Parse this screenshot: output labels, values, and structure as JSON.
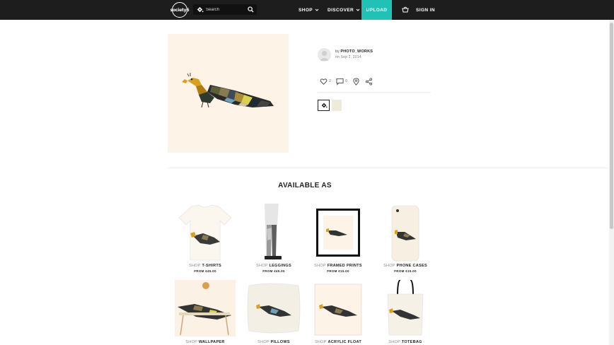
{
  "nav": {
    "logo_text": "society6",
    "search_placeholder": "Search",
    "shop": "SHOP",
    "discover": "DISCOVER",
    "upload": "UPLOAD",
    "sign_in": "SIGN IN"
  },
  "artwork": {
    "by_prefix": "by",
    "artist": "PHOTO_WORKS",
    "date": "on Sep 2, 2014",
    "likes": "2",
    "comments": "0"
  },
  "available_title": "AVAILABLE AS",
  "products": [
    {
      "shop": "SHOP",
      "name": "T-SHIRTS",
      "price": "FROM €45.00"
    },
    {
      "shop": "SHOP",
      "name": "LEGGINGS",
      "price": "FROM €45.00"
    },
    {
      "shop": "SHOP",
      "name": "FRAMED PRINTS",
      "price": "FROM €15.00"
    },
    {
      "shop": "SHOP",
      "name": "PHONE CASES",
      "price": "FROM €15.00"
    },
    {
      "shop": "SHOP",
      "name": "WALLPAPER"
    },
    {
      "shop": "SHOP",
      "name": "PILLOWS"
    },
    {
      "shop": "SHOP",
      "name": "ACRYLIC FLOAT"
    },
    {
      "shop": "SHOP",
      "name": "TOTEBAG"
    }
  ],
  "colors": {
    "nav_bg": "#1d1d1d",
    "upload_accent": "#20c2b5",
    "art_bg": "#fdf3e7"
  },
  "icons": [
    "logo-icon",
    "paint-bucket-icon",
    "search-icon",
    "chevron-down-icon",
    "cart-icon",
    "heart-icon",
    "comment-icon",
    "location-pin-icon",
    "share-icon"
  ]
}
